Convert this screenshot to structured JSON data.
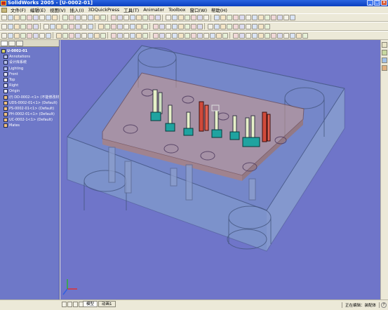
{
  "window": {
    "title": "SolidWorks 2005 - [U-0002-01]"
  },
  "menu": [
    "文件(F)",
    "编辑(E)",
    "视图(V)",
    "插入(I)",
    "3DQuickPress",
    "工具(T)",
    "Animator",
    "Toolbox",
    "窗口(W)",
    "帮助(H)"
  ],
  "tree": {
    "root": "U-0002-01",
    "items": [
      {
        "label": "Annotations",
        "level": "child"
      },
      {
        "label": "设计库系统",
        "level": "child"
      },
      {
        "label": "Lighting",
        "level": "child"
      },
      {
        "label": "Front",
        "level": "lvl2"
      },
      {
        "label": "Top",
        "level": "lvl2"
      },
      {
        "label": "Right",
        "level": "lvl2"
      },
      {
        "label": "Origin",
        "level": "lvl2"
      },
      {
        "label": "(f) DD-0002-<1> (不能修改材料)",
        "level": "part"
      },
      {
        "label": "UDS-0002-01<1> (Default)",
        "level": "part"
      },
      {
        "label": "PS-0002-01<1> (Default)",
        "level": "part"
      },
      {
        "label": "PH-0002-01<1> (Default)",
        "level": "part"
      },
      {
        "label": "UC-0002-1<1> (Default)",
        "level": "part"
      },
      {
        "label": "Mates",
        "level": "part"
      }
    ]
  },
  "tabs": {
    "model": "模型",
    "animation": "动画1"
  },
  "status": {
    "editing": "正在编辑：装配体"
  },
  "colors": {
    "viewport": "#6f75c9",
    "panel": "#6e78c8",
    "plate": "#8fb0c8",
    "accent": "#2b65e0"
  }
}
